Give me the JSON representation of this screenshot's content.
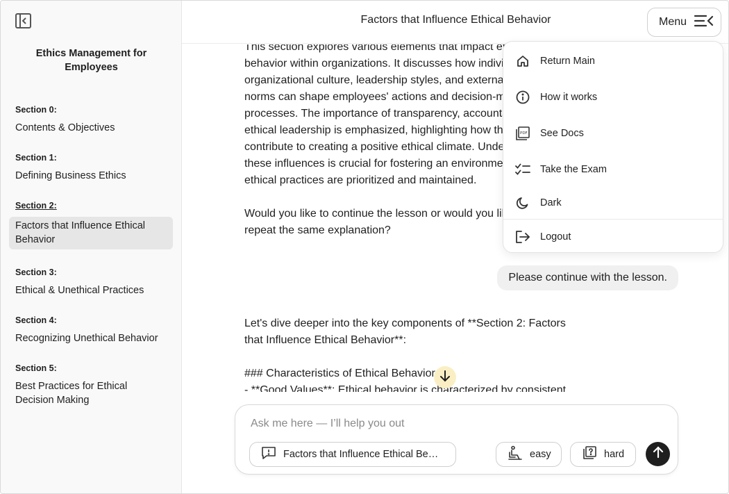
{
  "sidebar": {
    "course_title": "Ethics Management for Employees",
    "sections": [
      {
        "num": "Section 0:",
        "name": "Contents & Objectives"
      },
      {
        "num": "Section 1:",
        "name": "Defining Business Ethics"
      },
      {
        "num": "Section 2:",
        "name": "Factors that Influence Ethical Behavior",
        "active": true
      },
      {
        "num": "Section 3:",
        "name": "Ethical & Unethical Practices"
      },
      {
        "num": "Section 4:",
        "name": "Recognizing Unethical Behavior"
      },
      {
        "num": "Section 5:",
        "name": "Best Practices for Ethical Decision Making"
      }
    ]
  },
  "header": {
    "title": "Factors that Influence Ethical Behavior",
    "menu_label": "Menu"
  },
  "menu": {
    "items": [
      {
        "label": "Return Main",
        "icon": "home-icon"
      },
      {
        "label": "How it works",
        "icon": "info-icon"
      },
      {
        "label": "See Docs",
        "icon": "pdf-icon"
      },
      {
        "label": "Take the Exam",
        "icon": "checklist-icon"
      },
      {
        "label": "Dark",
        "icon": "moon-icon"
      },
      {
        "label": "Logout",
        "icon": "logout-icon"
      }
    ]
  },
  "chat": {
    "assistant_1": "This section explores various elements that impact ethical\nbehavior within organizations. It discusses how individual,\norganizational culture, leadership styles, and external\nnorms can shape employees' actions and decision-making\nprocesses. The importance of transparency, accountability,\nethical leadership is emphasized, highlighting how these\ncontribute to creating a positive ethical climate. Under\nthese influences is crucial for fostering an environment\nethical practices are prioritized and maintained.\n\nWould you like to continue the lesson or would you like to\nrepeat the same explanation?",
    "user_1": "Please continue with the lesson.",
    "assistant_2": "Let's dive deeper into the key components of **Section 2: Factors\nthat Influence Ethical Behavior**:\n\n### Characteristics of Ethical Behavior\n- **Good Values**: Ethical behavior is characterized by consistent"
  },
  "composer": {
    "placeholder": "Ask me here — I’ll help you out",
    "topic_chip": "Factors that Influence Ethical Behavior",
    "easy_label": "easy",
    "hard_label": "hard"
  },
  "colors": {
    "accent_dark": "#1f1f1f",
    "scroll_button_bg": "#faefc4",
    "active_section_bg": "#e6e6e6"
  }
}
